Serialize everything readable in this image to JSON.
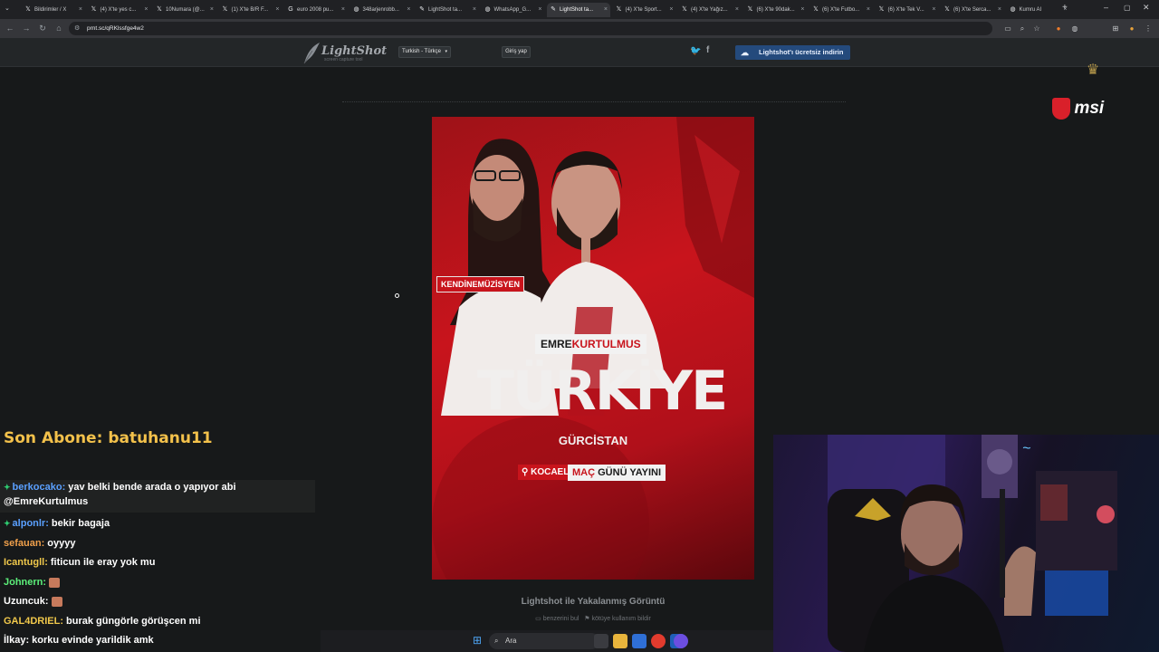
{
  "browser": {
    "tabs": [
      {
        "label": "Bildirimler / X",
        "icon": "x-icon"
      },
      {
        "label": "(4) X'te yes c...",
        "icon": "x-icon"
      },
      {
        "label": "10Numara (@...",
        "icon": "x-icon"
      },
      {
        "label": "(1) X'te B/R F...",
        "icon": "x-icon"
      },
      {
        "label": "euro 2008 pu...",
        "icon": "google-icon"
      },
      {
        "label": "348arjenrobb...",
        "icon": "globe-icon"
      },
      {
        "label": "LightShot ta...",
        "icon": "lightshot-icon"
      },
      {
        "label": "WhatsApp_G...",
        "icon": "globe-icon"
      },
      {
        "label": "LightShot ta...",
        "icon": "lightshot-icon",
        "active": true
      },
      {
        "label": "(4) X'te Sport...",
        "icon": "x-icon"
      },
      {
        "label": "(4) X'te Yağız...",
        "icon": "x-icon"
      },
      {
        "label": "(6) X'te 90dak...",
        "icon": "x-icon"
      },
      {
        "label": "(6) X'te Futbo...",
        "icon": "x-icon"
      },
      {
        "label": "(6) X'te Tek V...",
        "icon": "x-icon"
      },
      {
        "label": "(6) X'te Serca...",
        "icon": "x-icon"
      },
      {
        "label": "Kumru AI",
        "icon": "globe-icon"
      }
    ],
    "url": "prnt.sc/qRKlssfge4w2"
  },
  "lightshot": {
    "logo_text": "LightShot",
    "logo_subtext": "screen capture tool",
    "language": "Turkish - Türkçe",
    "login": "Giriş yap",
    "download": "Lightshot'ı ücretsiz indirin",
    "caption": "Lightshot ile Yakalanmış Görüntü",
    "similar": "benzerini bul",
    "report": "kötüye kullanım bildir"
  },
  "poster": {
    "kendine": "KENDİNE",
    "muzisyen": "MÜZİSYEN",
    "emre": "EMRE",
    "kurtulmus": "KURTULMUS",
    "title": "TÜRKİYE",
    "opponent": "GÜRCİSTAN",
    "location": "KOCAELİ",
    "mac": "MAÇ",
    "gunu": "GÜNÜ YAYINI"
  },
  "stream": {
    "sub_label": "Son Abone:",
    "sub_name": "batuhanu11",
    "chat": [
      {
        "nick": "berkocako:",
        "msg": "yav belki bende arada o yapıyor abi",
        "color": "#5aa0ff",
        "badge": true
      },
      {
        "nick": "",
        "msg": "@EmreKurtulmus",
        "color": "#ffffff"
      },
      {
        "nick": "alponlr:",
        "msg": "bekir bagaja",
        "color": "#5aa0ff",
        "badge": true
      },
      {
        "nick": "sefauan:",
        "msg": "oyyyy",
        "color": "#f0a04b"
      },
      {
        "nick": "Icantugll:",
        "msg": "fiticun ile eray yok mu",
        "color": "#f0c84b"
      },
      {
        "nick": "Johnern:",
        "msg": "",
        "color": "#5cf07a"
      },
      {
        "nick": "Uzuncuk:",
        "msg": "",
        "color": "#ffffff"
      },
      {
        "nick": "GAL4DRIEL:",
        "msg": "burak güngörle görüşcen mi",
        "color": "#f0c84b"
      },
      {
        "nick": "İlkay:",
        "msg": "korku evinde yarildik amk",
        "color": "#ffffff"
      }
    ],
    "sponsor": "msi"
  },
  "taskbar": {
    "search": "Ara"
  }
}
